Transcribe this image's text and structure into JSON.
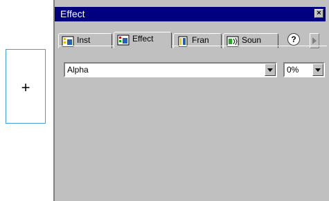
{
  "stage": {
    "symbol_glyph": "+"
  },
  "panel": {
    "title": "Effect",
    "close_glyph": "×",
    "tabs": [
      {
        "label": "Inst",
        "icon": "instance-icon",
        "active": false
      },
      {
        "label": "Effect",
        "icon": "effect-icon",
        "active": true
      },
      {
        "label": "Fran",
        "icon": "frame-icon",
        "active": false
      },
      {
        "label": "Soun",
        "icon": "sound-icon",
        "active": false
      }
    ],
    "help_glyph": "?",
    "effect_select": {
      "value": "Alpha"
    },
    "alpha_amount": {
      "value": "0%"
    }
  }
}
